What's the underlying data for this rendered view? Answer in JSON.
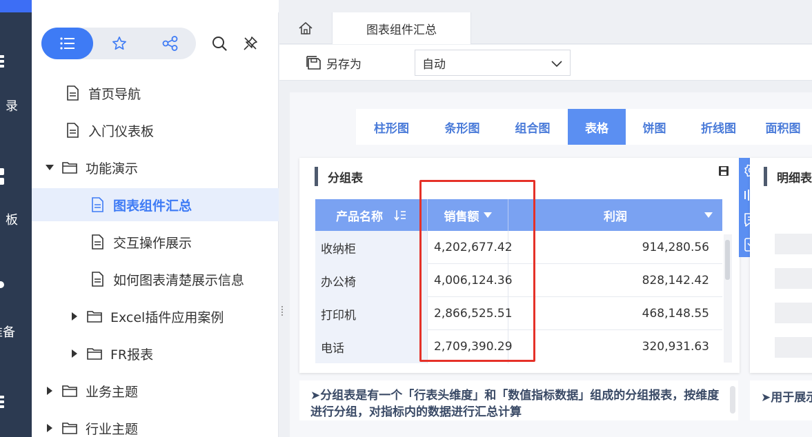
{
  "rail": {
    "items": [
      {
        "label": "录"
      },
      {
        "label": "板"
      },
      {
        "label": "准备"
      }
    ]
  },
  "directory": {
    "tree": [
      {
        "label": "首页导航",
        "type": "doc",
        "indent": 1
      },
      {
        "label": "入门仪表板",
        "type": "doc",
        "indent": 1
      },
      {
        "label": "功能演示",
        "type": "folder-open",
        "indent": 0
      },
      {
        "label": "图表组件汇总",
        "type": "doc",
        "indent": 2,
        "selected": true
      },
      {
        "label": "交互操作展示",
        "type": "doc",
        "indent": 2
      },
      {
        "label": "如何图表清楚展示信息",
        "type": "doc",
        "indent": 2
      },
      {
        "label": "Excel插件应用案例",
        "type": "folder",
        "indent": 1
      },
      {
        "label": "FR报表",
        "type": "folder",
        "indent": 1
      },
      {
        "label": "业务主题",
        "type": "folder",
        "indent": 0
      },
      {
        "label": "行业主题",
        "type": "folder",
        "indent": 0
      }
    ]
  },
  "tabs": {
    "active": "图表组件汇总"
  },
  "toolbar": {
    "save_as": "另存为",
    "zoom_value": "自动"
  },
  "chart_tabs": [
    {
      "label": "柱形图"
    },
    {
      "label": "条形图"
    },
    {
      "label": "组合图"
    },
    {
      "label": "表格",
      "active": true
    },
    {
      "label": "饼图"
    },
    {
      "label": "折线图"
    },
    {
      "label": "面积图"
    }
  ],
  "group_table": {
    "title": "分组表",
    "headers": {
      "name": "产品名称",
      "sales": "销售额",
      "profit": "利润"
    },
    "rows": [
      {
        "name": "收纳柜",
        "sales": "4,202,677.42",
        "profit": "914,280.56"
      },
      {
        "name": "办公椅",
        "sales": "4,006,124.36",
        "profit": "828,142.42"
      },
      {
        "name": "打印机",
        "sales": "2,866,525.51",
        "profit": "468,148.55"
      },
      {
        "name": "电话",
        "sales": "2,709,390.29",
        "profit": "320,931.63"
      }
    ]
  },
  "detail_table": {
    "title": "明细表"
  },
  "descriptions": {
    "group": "➤分组表是有一个「行表头维度」和「数值指标数据」组成的分组报表，按维度进行分组，对指标内的数据进行汇总计算",
    "detail": "➤用于展示"
  },
  "colors": {
    "accent": "#3e7bf5",
    "table_header": "#7aa2f2",
    "highlight_box": "#e53128",
    "rail": "#2c3a51"
  }
}
